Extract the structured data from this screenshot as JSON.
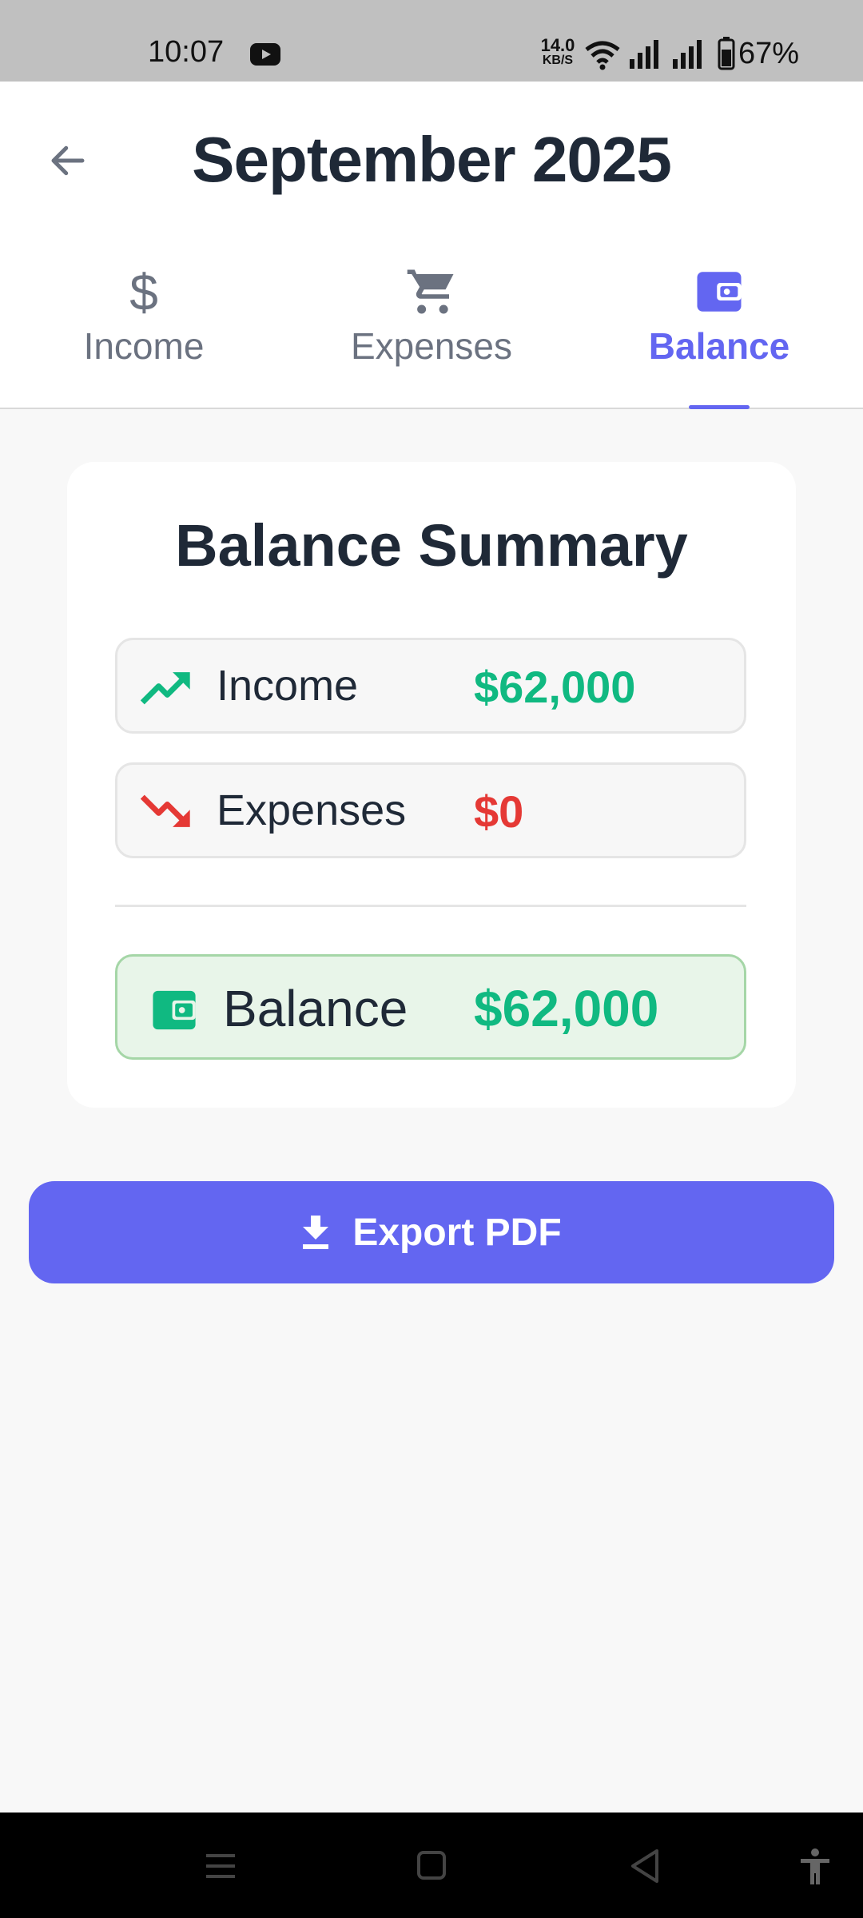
{
  "status_bar": {
    "time": "10:07",
    "net_speed_value": "14.0",
    "net_speed_unit": "KB/S",
    "battery": "67%",
    "icons": [
      "youtube-icon",
      "wifi-icon",
      "signal-icon",
      "signal-icon",
      "battery-icon"
    ]
  },
  "header": {
    "title": "September 2025",
    "back_icon": "arrow-left-icon"
  },
  "tabs": [
    {
      "label": "Income",
      "icon": "dollar-icon",
      "active": false
    },
    {
      "label": "Expenses",
      "icon": "cart-icon",
      "active": false
    },
    {
      "label": "Balance",
      "icon": "wallet-icon",
      "active": true
    }
  ],
  "summary": {
    "title": "Balance Summary",
    "income": {
      "label": "Income",
      "value": "$62,000",
      "icon": "trending-up-icon"
    },
    "expenses": {
      "label": "Expenses",
      "value": "$0",
      "icon": "trending-down-icon"
    },
    "balance": {
      "label": "Balance",
      "value": "$62,000",
      "icon": "wallet-icon"
    }
  },
  "export_button": {
    "label": "Export PDF",
    "icon": "download-icon"
  },
  "colors": {
    "accent": "#6366f1",
    "income_green": "#10b981",
    "expense_red": "#e53935",
    "balance_bg": "#e8f5e9",
    "balance_border": "#a5d6a7",
    "text_dark": "#1f2937",
    "text_muted": "#6b7280"
  },
  "nav_bar": {
    "icons": [
      "menu-icon",
      "home-square-icon",
      "back-triangle-icon",
      "accessibility-icon"
    ]
  }
}
